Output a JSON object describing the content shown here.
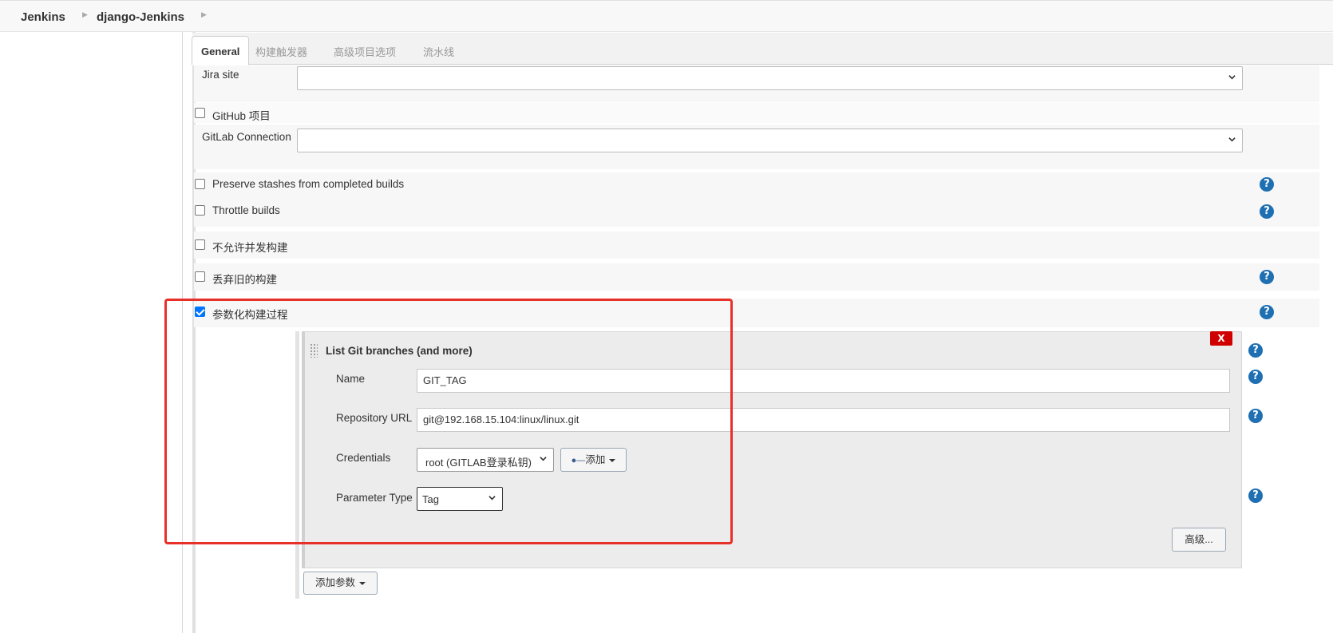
{
  "breadcrumb": {
    "root": "Jenkins",
    "project": "django-Jenkins"
  },
  "tabs": [
    "General",
    "构建触发器",
    "高级项目选项",
    "流水线"
  ],
  "fields": {
    "jira_site": {
      "label": "Jira site",
      "value": ""
    },
    "github_project": {
      "label": "GitHub 项目",
      "checked": false
    },
    "gitlab_connection": {
      "label": "GitLab Connection",
      "value": ""
    },
    "preserve_stashes": {
      "label": "Preserve stashes from completed builds",
      "checked": false
    },
    "throttle_builds": {
      "label": "Throttle builds",
      "checked": false
    },
    "no_concurrent": {
      "label": "不允许并发构建",
      "checked": false
    },
    "discard_old": {
      "label": "丢弃旧的构建",
      "checked": false
    },
    "parameterized": {
      "label": "参数化构建过程",
      "checked": true
    }
  },
  "parameter": {
    "title": "List Git branches (and more)",
    "delete_label": "X",
    "name_label": "Name",
    "name_value": "GIT_TAG",
    "repo_label": "Repository URL",
    "repo_value": "git@192.168.15.104:linux/linux.git",
    "credentials_label": "Credentials",
    "credentials_value": "root (GITLAB登录私钥)",
    "add_label": "添加",
    "param_type_label": "Parameter Type",
    "param_type_value": "Tag",
    "advanced_label": "高级..."
  },
  "add_param_label": "添加参数",
  "help_glyph": "?",
  "colors": {
    "help": "#1f6fb3",
    "delete": "#d10000",
    "highlight": "#e8302a",
    "checkbox": "#0075ff"
  }
}
